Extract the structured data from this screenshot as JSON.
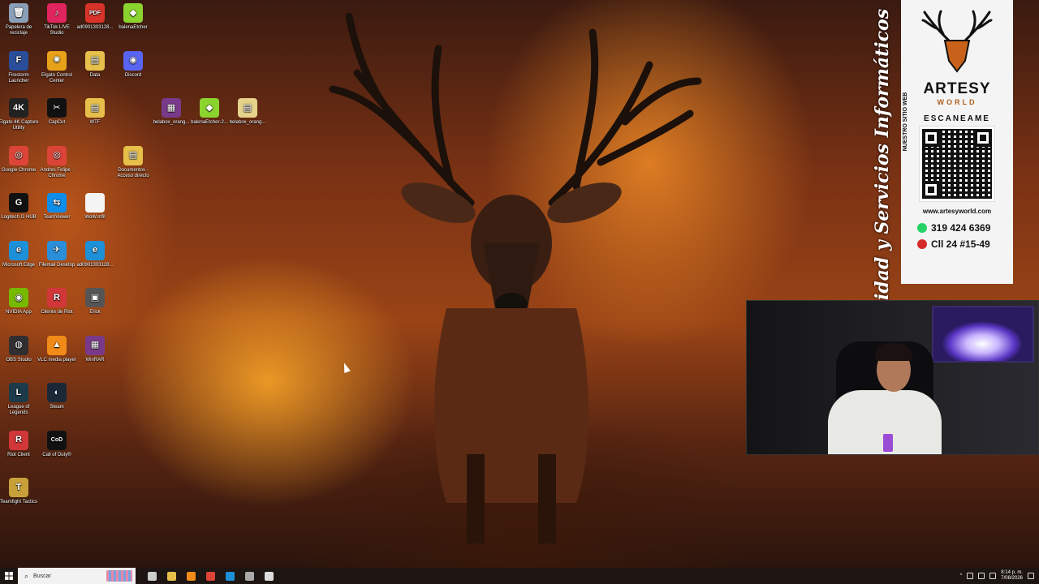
{
  "desktop": {
    "icons": [
      {
        "label": "Papelera de reciclaje",
        "icon": "recycle-bin-icon",
        "color": "#8aa0b8",
        "glyph": "🗑"
      },
      {
        "label": "TikTok LIVE Studio",
        "icon": "tiktok-icon",
        "color": "#e0245e",
        "glyph": "♪"
      },
      {
        "label": "ad0901303128...",
        "icon": "pdf-file-icon",
        "color": "#d8332a",
        "glyph": "PDF"
      },
      {
        "label": "balenaEtcher",
        "icon": "balena-icon",
        "color": "#8bd42f",
        "glyph": "◆"
      },
      {
        "label": "Firestorm Launcher",
        "icon": "firestorm-icon",
        "color": "#2a4e9a",
        "glyph": "F"
      },
      {
        "label": "Elgato Control Center",
        "icon": "elgato-icon",
        "color": "#e8a21a",
        "glyph": "✺"
      },
      {
        "label": "Data",
        "icon": "folder-icon",
        "color": "#e6c04a",
        "glyph": "▤"
      },
      {
        "label": "Discord",
        "icon": "discord-icon",
        "color": "#5865f2",
        "glyph": "◉"
      },
      {
        "label": "Elgato 4K Capture Utility",
        "icon": "elgato-4k-icon",
        "color": "#222",
        "glyph": "4K"
      },
      {
        "label": "CapCut",
        "icon": "capcut-icon",
        "color": "#111",
        "glyph": "✂"
      },
      {
        "label": "WTF",
        "icon": "folder-icon",
        "color": "#e6c04a",
        "glyph": "▤"
      },
      {
        "label": "belabox_orang...",
        "icon": "winrar-icon",
        "color": "#7a3a8a",
        "glyph": "▦"
      },
      {
        "label": "balenaEtcher-2...",
        "icon": "balena-icon",
        "color": "#8bd42f",
        "glyph": "◆"
      },
      {
        "label": "belabox_orang...",
        "icon": "archive-file-icon",
        "color": "#e6d28a",
        "glyph": "▤"
      },
      {
        "label": "Google Chrome",
        "icon": "chrome-icon",
        "color": "#db4437",
        "glyph": "◎"
      },
      {
        "label": "Andres Felipe - Chrome",
        "icon": "chrome-profile-icon",
        "color": "#db4437",
        "glyph": "◎"
      },
      {
        "label": "Documentos - Acceso directo",
        "icon": "documents-folder-icon",
        "color": "#e6c04a",
        "glyph": "▤"
      },
      {
        "label": "Logitech G HUB",
        "icon": "logitech-icon",
        "color": "#111",
        "glyph": "G"
      },
      {
        "label": "TeamViewer",
        "icon": "teamviewer-icon",
        "color": "#0e8ee9",
        "glyph": "⇆"
      },
      {
        "label": "WoW.mfil",
        "icon": "file-icon",
        "color": "#f4f4f4",
        "glyph": ""
      },
      {
        "label": "Microsoft Edge",
        "icon": "edge-icon",
        "color": "#1e90d8",
        "glyph": "e"
      },
      {
        "label": "Filemail Desktop",
        "icon": "filemail-icon",
        "color": "#2a8fd8",
        "glyph": "✈"
      },
      {
        "label": "ad0901303128...",
        "icon": "edge-file-icon",
        "color": "#1e90d8",
        "glyph": "e"
      },
      {
        "label": "NVIDIA App",
        "icon": "nvidia-icon",
        "color": "#76b900",
        "glyph": "◉"
      },
      {
        "label": "Cliente de Riot",
        "icon": "riot-icon",
        "color": "#d13639",
        "glyph": "R"
      },
      {
        "label": "Erick",
        "icon": "image-file-icon",
        "color": "#555",
        "glyph": "▣"
      },
      {
        "label": "OBS Studio",
        "icon": "obs-icon",
        "color": "#302e31",
        "glyph": "◍"
      },
      {
        "label": "VLC media player",
        "icon": "vlc-icon",
        "color": "#f08a18",
        "glyph": "▲"
      },
      {
        "label": "WinRAR",
        "icon": "winrar-icon",
        "color": "#7a3a8a",
        "glyph": "▦"
      },
      {
        "label": "League of Legends",
        "icon": "league-icon",
        "color": "#1c3a4a",
        "glyph": "L"
      },
      {
        "label": "Steam",
        "icon": "steam-icon",
        "color": "#1b2838",
        "glyph": "◐"
      },
      {
        "label": "Riot Client",
        "icon": "riot-client-icon",
        "color": "#d13639",
        "glyph": "R"
      },
      {
        "label": "Call of Duty®",
        "icon": "call-of-duty-icon",
        "color": "#111",
        "glyph": "CoD"
      },
      {
        "label": "Teamfight Tactics",
        "icon": "tft-icon",
        "color": "#c8a03a",
        "glyph": "T"
      }
    ]
  },
  "banner": {
    "brand": "ARTESY",
    "brand_sub": "WORLD",
    "scan_label": "ESCANEAME",
    "site_label": "NUESTRO SITIO WEB",
    "url": "www.artesyworld.com",
    "phone": "319 424 6369",
    "address": "Cll 24 #15-49",
    "vertical_text": "idad y Servicios Informáticos"
  },
  "taskbar": {
    "search_placeholder": "Buscar",
    "time": "8:14 p. m.",
    "date": "7/08/2026",
    "apps": [
      {
        "name": "task-view-icon",
        "color": "#cccccc"
      },
      {
        "name": "file-explorer-icon",
        "color": "#e6c04a"
      },
      {
        "name": "vlc-taskbar-icon",
        "color": "#f08a18"
      },
      {
        "name": "chrome-taskbar-icon",
        "color": "#db4437"
      },
      {
        "name": "edge-taskbar-icon",
        "color": "#1e90d8"
      },
      {
        "name": "obs-taskbar-icon",
        "color": "#aaaaaa"
      },
      {
        "name": "app-taskbar-icon",
        "color": "#dddddd"
      }
    ]
  }
}
